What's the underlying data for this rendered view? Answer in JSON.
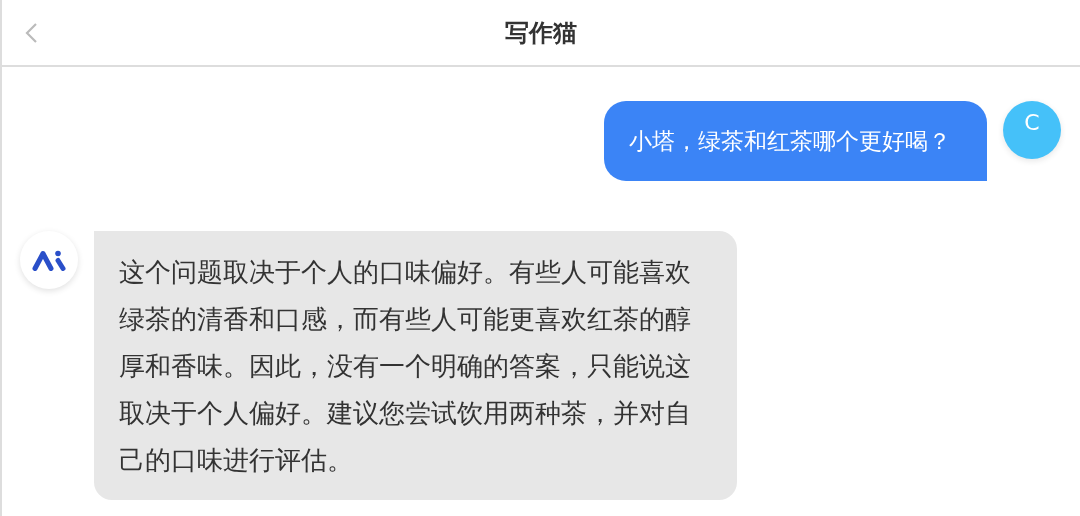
{
  "header": {
    "title": "写作猫"
  },
  "messages": [
    {
      "kind": "user",
      "avatar": "C",
      "text": "小塔，绿茶和红茶哪个更好喝？"
    },
    {
      "kind": "assistant",
      "text": "这个问题取决于个人的口味偏好。有些人可能喜欢绿茶的清香和口感，而有些人可能更喜欢红茶的醇厚和香味。因此，没有一个明确的答案，只能说这取决于个人偏好。建议您尝试饮用两种茶，并对自己的口味进行评估。"
    }
  ]
}
